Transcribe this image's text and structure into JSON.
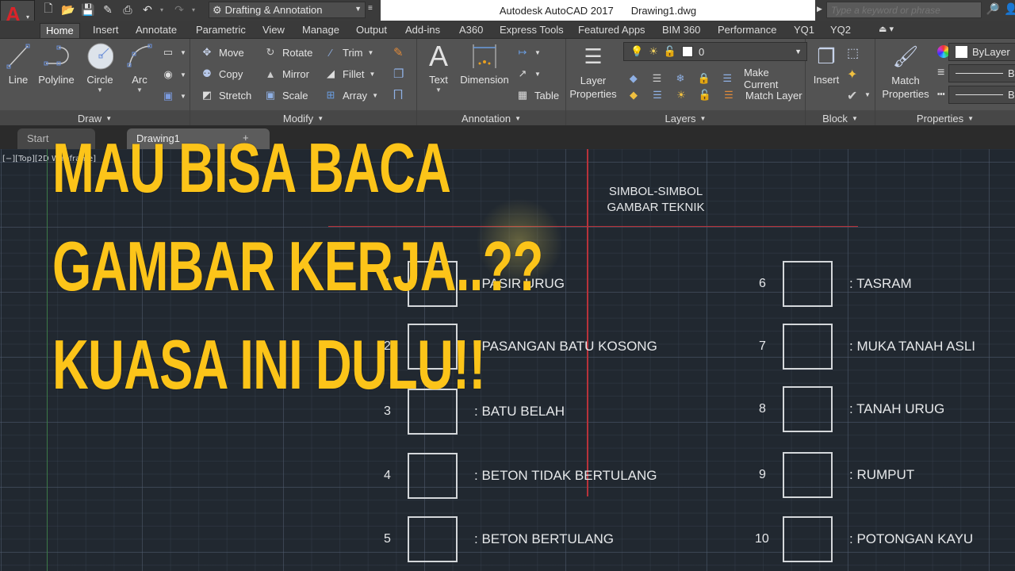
{
  "titlebar": {
    "app_logo": "A",
    "workspace": "Drafting & Annotation",
    "product": "Autodesk AutoCAD 2017",
    "document": "Drawing1.dwg",
    "search_placeholder": "Type a keyword or phrase",
    "qat_icons": [
      "new-icon",
      "open-icon",
      "save-icon",
      "save-as-icon",
      "plot-icon",
      "undo-icon",
      "redo-icon"
    ]
  },
  "ribbon_tabs": [
    "Home",
    "Insert",
    "Annotate",
    "Parametric",
    "View",
    "Manage",
    "Output",
    "Add-ins",
    "A360",
    "Express Tools",
    "Featured Apps",
    "BIM 360",
    "Performance",
    "YQ1",
    "YQ2"
  ],
  "active_tab": "Home",
  "ribbon": {
    "draw": {
      "title": "Draw",
      "tools": [
        "Line",
        "Polyline",
        "Circle",
        "Arc"
      ]
    },
    "modify": {
      "title": "Modify",
      "col1": [
        "Move",
        "Copy",
        "Stretch"
      ],
      "col2": [
        "Rotate",
        "Mirror",
        "Scale"
      ],
      "col3": [
        "Trim",
        "Fillet",
        "Array"
      ]
    },
    "annotation": {
      "title": "Annotation",
      "text": "Text",
      "dimension": "Dimension",
      "table": "Table"
    },
    "layers": {
      "title": "Layers",
      "layer_properties": [
        "Layer",
        "Properties"
      ],
      "current_layer": "0",
      "make_current": "Make Current",
      "match_layer": "Match Layer"
    },
    "block": {
      "title": "Block",
      "insert": "Insert"
    },
    "properties": {
      "title": "Properties",
      "match_properties": [
        "Match",
        "Properties"
      ],
      "color": "ByLayer",
      "linetype": "B",
      "lineweight": "B"
    }
  },
  "file_tabs": {
    "start": "Start",
    "drawing": "Drawing1",
    "plus": "+"
  },
  "viewport_label": "[−][Top][2D Wireframe]",
  "drawing": {
    "title_line1": "SIMBOL-SIMBOL",
    "title_line2": "GAMBAR TEKNIK",
    "symbols_left": [
      {
        "num": "1",
        "label": ": PASIR URUG"
      },
      {
        "num": "2",
        "label": ": PASANGAN BATU KOSONG"
      },
      {
        "num": "3",
        "label": ": BATU BELAH"
      },
      {
        "num": "4",
        "label": ": BETON TIDAK BERTULANG"
      },
      {
        "num": "5",
        "label": ": BETON BERTULANG"
      }
    ],
    "symbols_right": [
      {
        "num": "6",
        "label": ": TASRAM"
      },
      {
        "num": "7",
        "label": ": MUKA TANAH ASLI"
      },
      {
        "num": "8",
        "label": ": TANAH URUG"
      },
      {
        "num": "9",
        "label": ": RUMPUT"
      },
      {
        "num": "10",
        "label": ": POTONGAN KAYU"
      }
    ]
  },
  "overlay": {
    "line1": "MAU BISA BACA",
    "line2": "GAMBAR KERJA..??",
    "line3": "KUASA INI DULU!!",
    "color": "#fcc419"
  }
}
